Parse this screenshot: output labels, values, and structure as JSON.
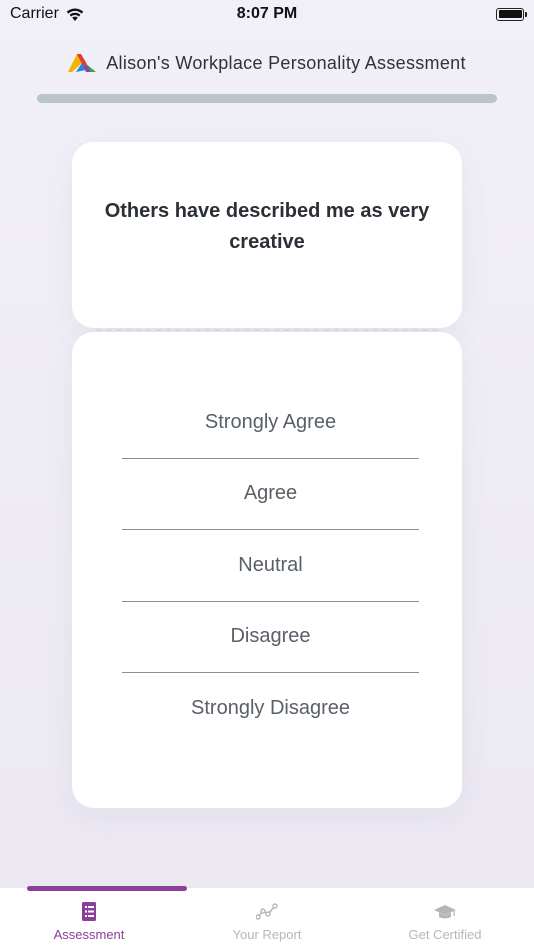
{
  "status_bar": {
    "carrier": "Carrier",
    "time": "8:07 PM"
  },
  "header": {
    "title": "Alison's Workplace Personality Assessment",
    "logo_icon": "alison-logo-icon"
  },
  "question": {
    "text": "Others have described me as very creative"
  },
  "answers": [
    {
      "label": "Strongly Agree"
    },
    {
      "label": "Agree"
    },
    {
      "label": "Neutral"
    },
    {
      "label": "Disagree"
    },
    {
      "label": "Strongly Disagree"
    }
  ],
  "tabs": [
    {
      "label": "Assessment",
      "icon": "document-list-icon",
      "active": true
    },
    {
      "label": "Your Report",
      "icon": "line-chart-icon",
      "active": false
    },
    {
      "label": "Get Certified",
      "icon": "graduation-cap-icon",
      "active": false
    }
  ],
  "colors": {
    "accent": "#8c3e9b",
    "progress_track": "#b9c5cb",
    "inactive_tab": "#b3b7bc"
  }
}
